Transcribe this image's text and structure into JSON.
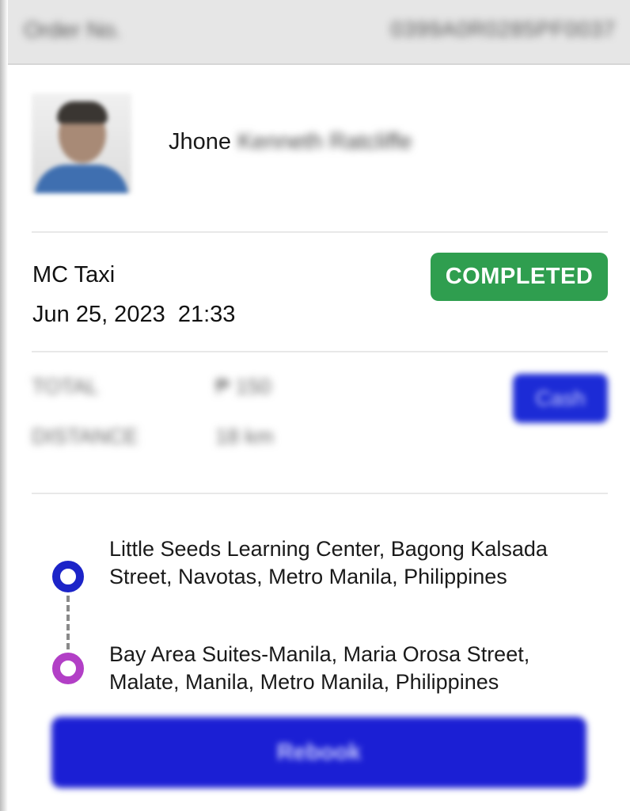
{
  "order": {
    "label": "Order No.",
    "number": "0399A0R0285PF0037"
  },
  "driver": {
    "name_visible": "Jhone",
    "name_obscured": "Kenneth Ratcliffe"
  },
  "service": {
    "name": "MC Taxi",
    "date": "Jun 25, 2023  21:33",
    "status": "COMPLETED",
    "status_color": "#2f9e4f"
  },
  "summary": {
    "total_label": "TOTAL",
    "total_value": "₱ 150",
    "distance_label": "DISTANCE",
    "distance_value": "18 km",
    "payment_method": "Cash"
  },
  "route": {
    "pickup": "Little Seeds Learning Center, Bagong Kalsada Street, Navotas, Metro Manila, Philippines",
    "dropoff": "Bay Area Suites-Manila, Maria Orosa Street, Malate, Manila, Metro Manila, Philippines",
    "pickup_color": "#1c24c8",
    "dropoff_color": "#b23fc6"
  },
  "actions": {
    "rebook_label": "Rebook",
    "primary_color": "#1b1fd4"
  }
}
